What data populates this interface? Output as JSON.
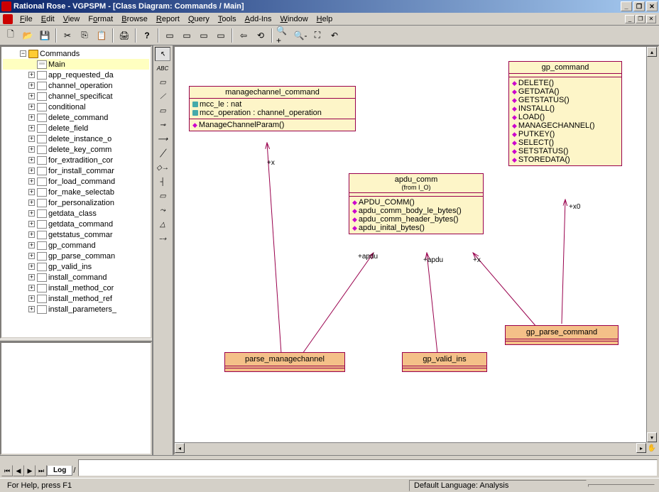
{
  "window": {
    "title": "Rational Rose - VGPSPM - [Class Diagram: Commands / Main]"
  },
  "menu": {
    "items": [
      "File",
      "Edit",
      "View",
      "Format",
      "Browse",
      "Report",
      "Query",
      "Tools",
      "Add-Ins",
      "Window",
      "Help"
    ]
  },
  "tree": {
    "root": "Commands",
    "selected": "Main",
    "items": [
      "Main",
      "app_requested_da",
      "channel_operation",
      "channel_specificat",
      "conditional",
      "delete_command",
      "delete_field",
      "delete_instance_o",
      "delete_key_comm",
      "for_extradition_cor",
      "for_install_commar",
      "for_load_command",
      "for_make_selectab",
      "for_personalization",
      "getdata_class",
      "getdata_command",
      "getstatus_commar",
      "gp_command",
      "gp_parse_comman",
      "gp_valid_ins",
      "install_command",
      "install_method_cor",
      "install_method_ref",
      "install_parameters_"
    ]
  },
  "classes": {
    "managechannel": {
      "name": "managechannel_command",
      "attrs": [
        "mcc_le : nat",
        "mcc_operation : channel_operation"
      ],
      "ops": [
        "ManageChannelParam()"
      ]
    },
    "apdu": {
      "name": "apdu_comm",
      "from": "(from I_O)",
      "ops": [
        "APDU_COMM()",
        "apdu_comm_body_le_bytes()",
        "apdu_comm_header_bytes()",
        "apdu_inital_bytes()"
      ]
    },
    "gp_command": {
      "name": "gp_command",
      "ops": [
        "DELETE()",
        "GETDATA()",
        "GETSTATUS()",
        "INSTALL()",
        "LOAD()",
        "MANAGECHANNEL()",
        "PUTKEY()",
        "SELECT()",
        "SETSTATUS()",
        "STOREDATA()"
      ]
    },
    "parse_managechannel": "parse_managechannel",
    "gp_valid_ins": "gp_valid_ins",
    "gp_parse_command": "gp_parse_command"
  },
  "assoc_labels": {
    "x1": "+x",
    "apdu1": "+apdu",
    "apdu2": "+apdu",
    "x2": "+x",
    "x0": "+x0"
  },
  "log": {
    "tab": "Log"
  },
  "status": {
    "help": "For Help, press F1",
    "lang": "Default Language: Analysis"
  }
}
